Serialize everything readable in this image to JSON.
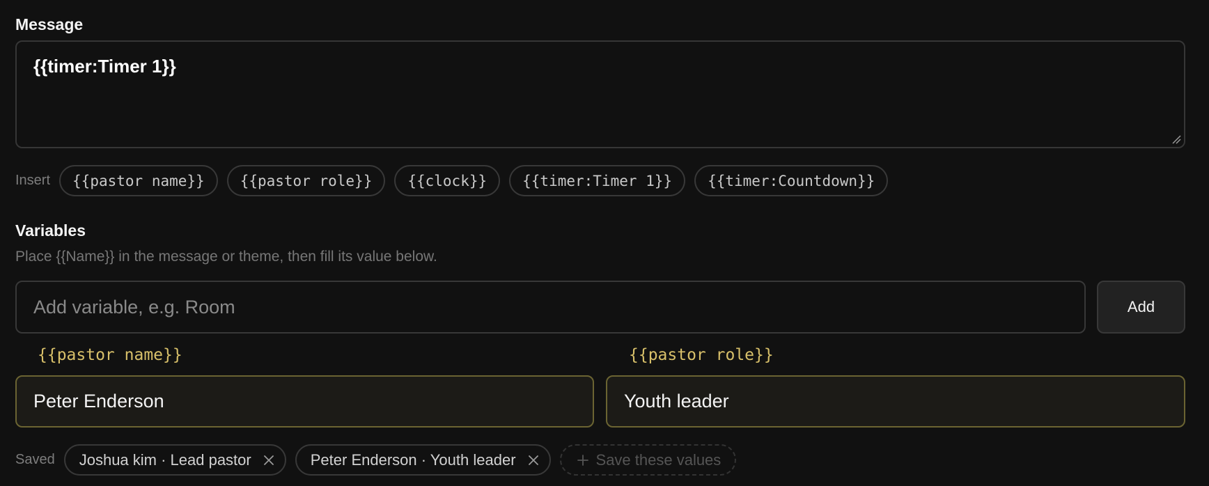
{
  "message": {
    "title": "Message",
    "value": "{{timer:Timer 1}}"
  },
  "insert": {
    "label": "Insert",
    "chips": [
      "{{pastor name}}",
      "{{pastor role}}",
      "{{clock}}",
      "{{timer:Timer 1}}",
      "{{timer:Countdown}}"
    ]
  },
  "variables": {
    "title": "Variables",
    "hint": "Place {{Name}} in the message or theme, then fill its value below.",
    "add_placeholder": "Add variable, e.g. Room",
    "add_label": "Add",
    "fields": [
      {
        "name": "{{pastor name}}",
        "value": "Peter Enderson"
      },
      {
        "name": "{{pastor role}}",
        "value": "Youth leader"
      }
    ]
  },
  "saved": {
    "label": "Saved",
    "items": [
      "Joshua kim · Lead pastor",
      "Peter Enderson · Youth leader"
    ],
    "save_label": "Save these values"
  },
  "icons": {
    "remove": "close-icon",
    "add": "plus-icon",
    "resize": "resize-handle-icon"
  },
  "colors": {
    "background": "#111111",
    "variable_accent": "#d8c06a",
    "variable_field_border": "#6b6432"
  }
}
